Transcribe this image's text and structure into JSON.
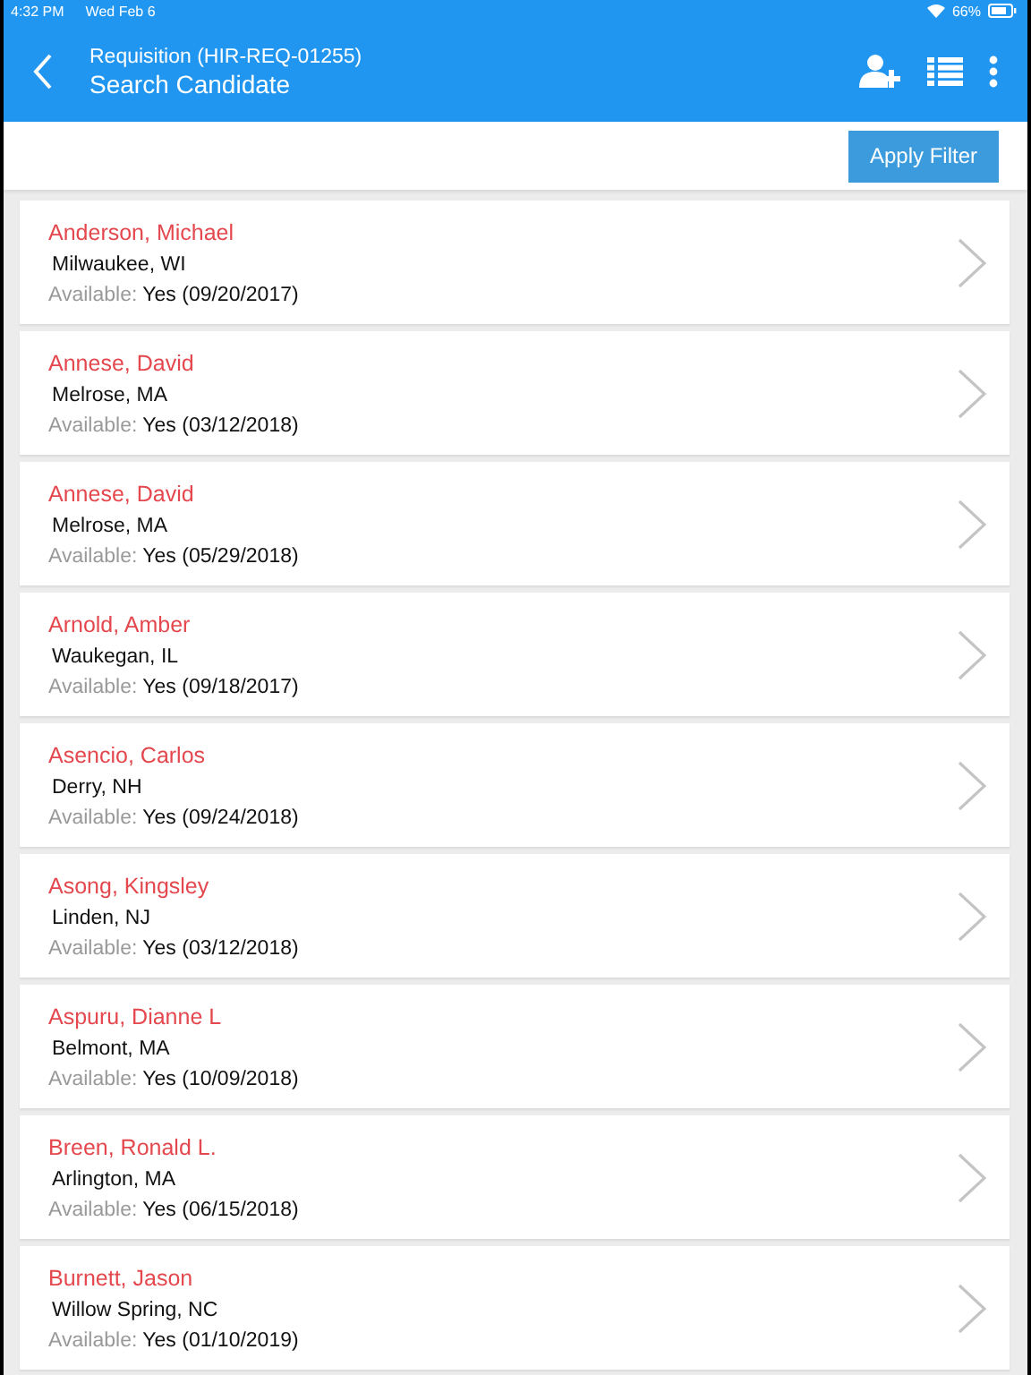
{
  "status_bar": {
    "time": "4:32 PM",
    "date": "Wed Feb 6",
    "battery": "66%"
  },
  "header": {
    "subtitle": "Requisition (HIR-REQ-01255)",
    "title": "Search Candidate"
  },
  "toolbar": {
    "apply_button": "Apply Filter"
  },
  "candidates": [
    {
      "name": "Anderson, Michael",
      "location": "Milwaukee, WI",
      "available_label": "Available:",
      "available": "Yes (09/20/2017)"
    },
    {
      "name": "Annese, David",
      "location": "Melrose, MA",
      "available_label": "Available:",
      "available": "Yes (03/12/2018)"
    },
    {
      "name": "Annese, David",
      "location": "Melrose, MA",
      "available_label": "Available:",
      "available": "Yes (05/29/2018)"
    },
    {
      "name": "Arnold, Amber",
      "location": "Waukegan, IL",
      "available_label": "Available:",
      "available": "Yes (09/18/2017)"
    },
    {
      "name": "Asencio, Carlos",
      "location": "Derry, NH",
      "available_label": "Available:",
      "available": "Yes (09/24/2018)"
    },
    {
      "name": "Asong, Kingsley",
      "location": "Linden, NJ",
      "available_label": "Available:",
      "available": "Yes (03/12/2018)"
    },
    {
      "name": "Aspuru, Dianne L",
      "location": "Belmont, MA",
      "available_label": "Available:",
      "available": "Yes (10/09/2018)"
    },
    {
      "name": "Breen, Ronald L.",
      "location": "Arlington, MA",
      "available_label": "Available:",
      "available": "Yes (06/15/2018)"
    },
    {
      "name": "Burnett, Jason",
      "location": "Willow Spring, NC",
      "available_label": "Available:",
      "available": "Yes (01/10/2019)"
    }
  ]
}
